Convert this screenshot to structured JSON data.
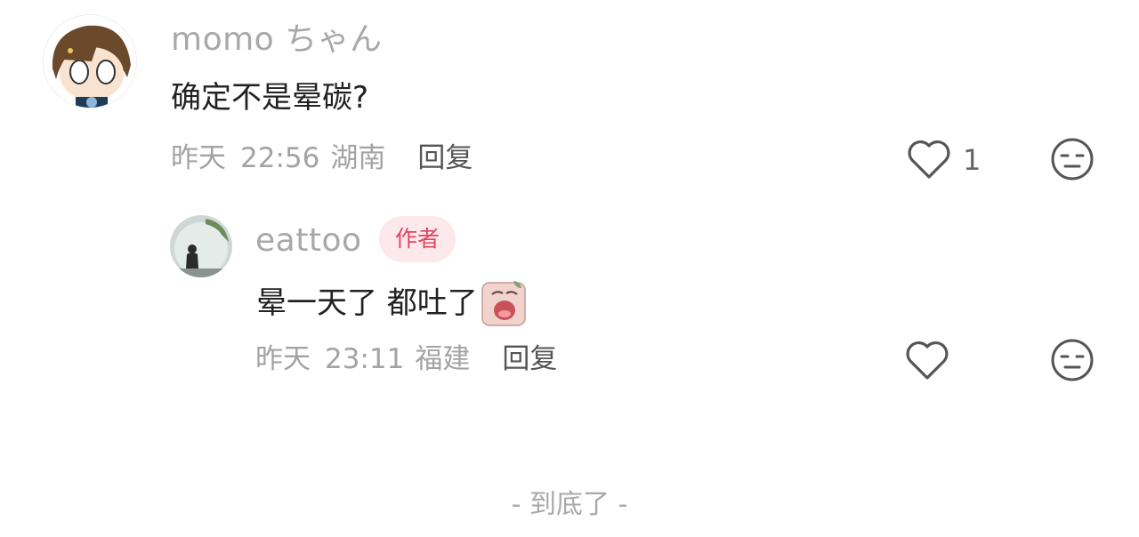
{
  "comment": {
    "user": "momo ちゃん",
    "text": "确定不是晕碳?",
    "date": "昨天",
    "time": "22:56",
    "location": "湖南",
    "reply_label": "回复",
    "like_count": "1"
  },
  "reply": {
    "user": "eattoo",
    "badge": "作者",
    "text": "晕一天了 都吐了",
    "date": "昨天",
    "time": "23:11",
    "location": "福建",
    "reply_label": "回复"
  },
  "footer": {
    "end_text": "- 到底了 -"
  },
  "colors": {
    "badge_bg": "#fde8ec",
    "badge_text": "#e0455e",
    "name": "#a8a8a8"
  },
  "icons": [
    "heart-outline-icon",
    "unamused-face-icon",
    "crying-emoji-icon"
  ]
}
